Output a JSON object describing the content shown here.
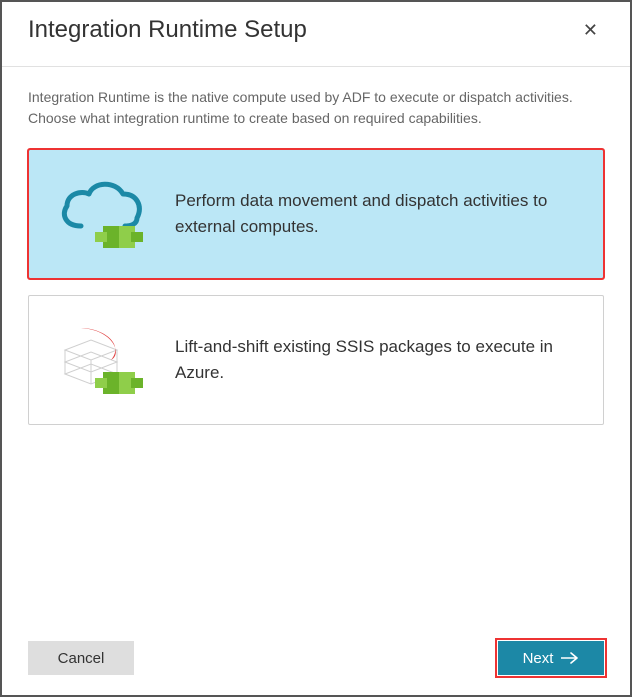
{
  "title": "Integration Runtime Setup",
  "intro": "Integration Runtime is the native compute used by ADF to execute or dispatch activities. Choose what integration runtime to create based on required capabilities.",
  "options": {
    "data_movement": "Perform data movement and dispatch activities to external computes.",
    "ssis": "Lift-and-shift existing SSIS packages to execute in Azure."
  },
  "buttons": {
    "cancel": "Cancel",
    "next": "Next"
  }
}
